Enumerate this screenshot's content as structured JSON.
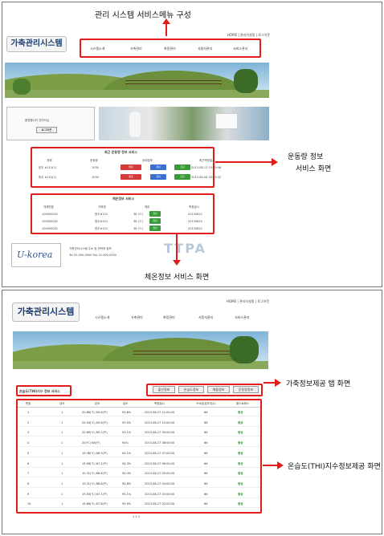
{
  "top_annotation": "관리 시스템 서비스메뉴 구성",
  "right_annotation_1_line1": "운동량 정보",
  "right_annotation_1_line2": "서비스 화면",
  "bottom_annotation_1": "체온정보 서비스 화면",
  "right_annotation_2": "가축정보제공 탭 화면",
  "right_annotation_3": "온습도(THI)지수정보제공 화면",
  "app_logo": "가축관리시스템",
  "top_links": "HOME | 관리자설정 | 로그아웃",
  "menu": [
    "시스템소개",
    "가축관리",
    "축정관리",
    "사용자관리",
    "서비스관리"
  ],
  "login_box_text": "환영합니다 관리자님",
  "login_button": "로그아웃",
  "movement_title": "최근 운동량 정보 서비스",
  "movement_headers": [
    "개체",
    "운동량",
    "상태정보",
    "",
    "",
    "최근측정일시"
  ],
  "movement_rows": [
    {
      "id": "한우 #101(1)",
      "value": "1030",
      "date": "2013-08-17 15:19:46"
    },
    {
      "id": "한우 #102(1)",
      "value": "1030",
      "date": "2013-08-06 18:39:32"
    }
  ],
  "movement_buttons": [
    "발정",
    "정상",
    "건강"
  ],
  "temperature_title": "체온정보 서비스",
  "temperature_headers": [
    "개체번호",
    "가축명",
    "체온",
    "측정일시"
  ],
  "temperature_rows": [
    {
      "id": "100000001",
      "name": "한우#101",
      "temp": "38 (℃)",
      "date": "20130822"
    },
    {
      "id": "100000001",
      "name": "한우#101",
      "temp": "38 (℃)",
      "date": "20130822"
    },
    {
      "id": "100000001",
      "name": "한우#101",
      "temp": "38 (℃)",
      "date": "20130822"
    }
  ],
  "temp_status": "정상",
  "footer_logo": "U-korea",
  "footer_text_1": "가축관리시스템 주소 및 연락처 정보",
  "footer_text_2": "Tel 02-000-0000 Fax 02-000-0000",
  "watermark": "TTPA",
  "thi_label": "온습도(THI)지수 정보 서비스",
  "info_tabs": [
    "출산정보",
    "온습도정보",
    "체중정보",
    "운동량정보"
  ],
  "thi_headers": [
    "번호",
    "센서",
    "온도",
    "습도",
    "측정일시",
    "THI(온습도지수)",
    "열스트레스"
  ],
  "thi_rows": [
    {
      "no": "1",
      "sensor": "1",
      "temp": "20.88(℃) 69.6(℉)",
      "hum": "93.8%",
      "date": "2013-08-27 11:00:00",
      "thi": "66",
      "status": "정상"
    },
    {
      "no": "2",
      "sensor": "1",
      "temp": "20.94(℃) 69.6(℉)",
      "hum": "93.5%",
      "date": "2013-08-27 10:00:00",
      "thi": "66",
      "status": "정상"
    },
    {
      "no": "3",
      "sensor": "1",
      "temp": "20.69(℃) 69.2(℉)",
      "hum": "93.1%",
      "date": "2013-08-27 09:00:00",
      "thi": "66",
      "status": "정상"
    },
    {
      "no": "4",
      "sensor": "1",
      "temp": "20(℃) 68(℉)",
      "hum": "94%",
      "date": "2013-08-27 08:00:00",
      "thi": "66",
      "status": "정상"
    },
    {
      "no": "5",
      "sensor": "1",
      "temp": "19.38(℃) 66.9(℉)",
      "hum": "94.1%",
      "date": "2013-08-27 07:00:00",
      "thi": "66",
      "status": "정상"
    },
    {
      "no": "6",
      "sensor": "1",
      "temp": "19.56(℃) 67.2(℉)",
      "hum": "94.3%",
      "date": "2013-08-27 06:00:00",
      "thi": "66",
      "status": "정상"
    },
    {
      "no": "7",
      "sensor": "1",
      "temp": "19.31(℃) 66.8(℉)",
      "hum": "94.4%",
      "date": "2013-08-27 05:00:00",
      "thi": "66",
      "status": "정상"
    },
    {
      "no": "8",
      "sensor": "1",
      "temp": "19.31(℃) 66.8(℉)",
      "hum": "94.8%",
      "date": "2013-08-27 04:00:00",
      "thi": "66",
      "status": "정상"
    },
    {
      "no": "9",
      "sensor": "1",
      "temp": "19.50(℃) 67.1(℉)",
      "hum": "95.1%",
      "date": "2013-08-27 03:00:00",
      "thi": "66",
      "status": "정상"
    },
    {
      "no": "10",
      "sensor": "1",
      "temp": "19.88(℃) 67.8(℉)",
      "hum": "95.5%",
      "date": "2013-08-27 02:00:00",
      "thi": "66",
      "status": "정상"
    }
  ],
  "pagination": "1 2 3",
  "colors": {
    "annotation_red": "#e21b1b",
    "btn_red": "#d43a3a",
    "btn_blue": "#3c6fd0",
    "btn_green": "#3a9a3a",
    "good_green": "#1c8c1c"
  }
}
